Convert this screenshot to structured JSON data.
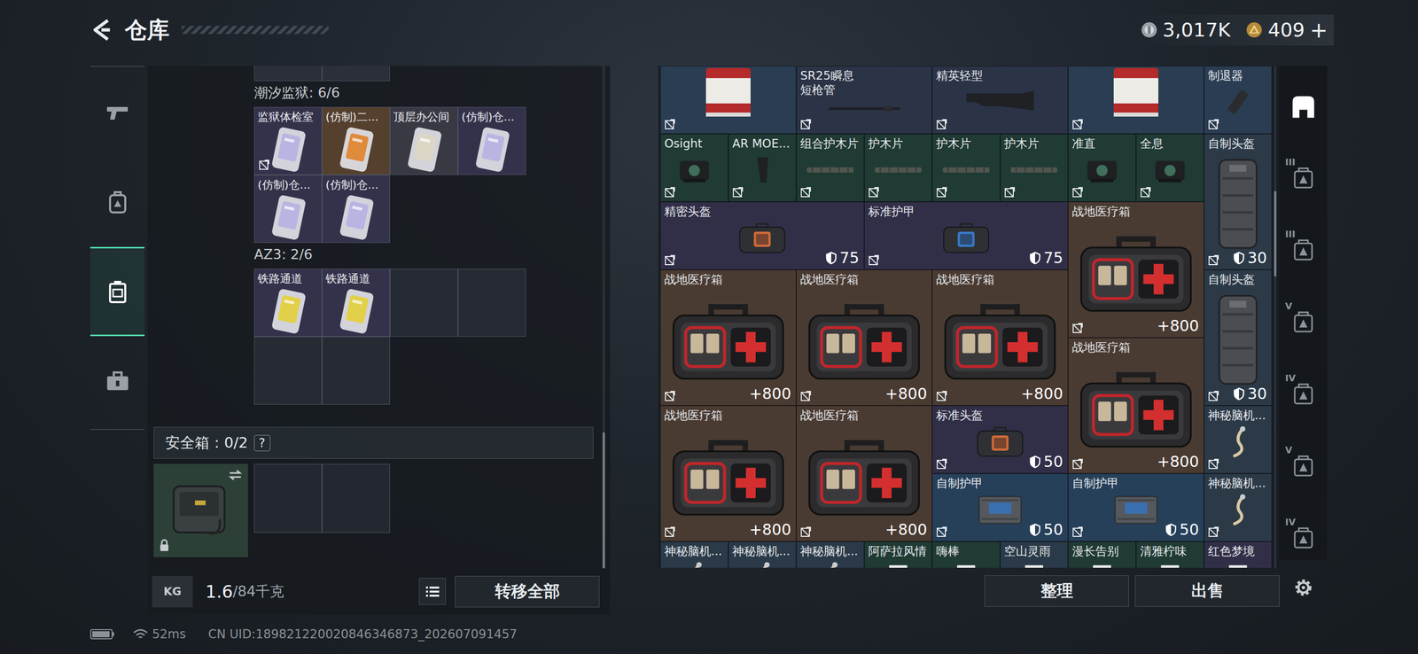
{
  "topbar": {
    "title": "仓库",
    "currencies": [
      {
        "kind": "coin",
        "value": "3,017K",
        "action": ""
      },
      {
        "kind": "gem",
        "value": "409",
        "action": "+"
      }
    ]
  },
  "rail": [
    {
      "kind": "weapon",
      "selected": false
    },
    {
      "kind": "gear",
      "selected": false
    },
    {
      "kind": "storage",
      "selected": true
    },
    {
      "kind": "tools",
      "selected": false
    }
  ],
  "keys": {
    "cut_row_cells": 2,
    "scrollbar": {
      "level": 0.27,
      "position": 1
    },
    "sections": [
      {
        "title": "潮汐监狱: 6/6",
        "slots": [
          {
            "name": "监狱体检室",
            "filled": true,
            "marked": true,
            "color": "#34324b",
            "card": "#b9b5e2"
          },
          {
            "name": "(仿制)二...",
            "filled": true,
            "marked": false,
            "color": "#55402e",
            "card": "#e08a3c"
          },
          {
            "name": "顶层办公间",
            "filled": true,
            "marked": false,
            "color": "#393944",
            "card": "#dcd6c6"
          },
          {
            "name": "(仿制)仓...",
            "filled": true,
            "marked": false,
            "color": "#34324b",
            "card": "#b9b5e2"
          },
          {
            "name": "(仿制)仓...",
            "filled": true,
            "marked": false,
            "color": "#34324b",
            "card": "#b9b5e2"
          },
          {
            "name": "(仿制)仓...",
            "filled": true,
            "marked": false,
            "color": "#34324b",
            "card": "#b9b5e2"
          }
        ]
      },
      {
        "title": "AZ3: 2/6",
        "slots": [
          {
            "name": "铁路通道",
            "filled": true,
            "marked": false,
            "color": "#34324b",
            "card": "#e2d04a"
          },
          {
            "name": "铁路通道",
            "filled": true,
            "marked": false,
            "color": "#34324b",
            "card": "#e2d04a"
          },
          {
            "filled": false
          },
          {
            "filled": false
          },
          {
            "filled": false
          },
          {
            "filled": false
          }
        ]
      }
    ]
  },
  "safebox": {
    "title": "安全箱：0/2",
    "help": "?",
    "case": {
      "locked": true
    },
    "slots": [
      {
        "filled": false
      },
      {
        "filled": false
      }
    ]
  },
  "weight": {
    "icon_text": "KG",
    "value": "1.6",
    "capacity": "/84千克"
  },
  "transfer_button": "转移全部",
  "storage": {
    "scrollbar": {
      "level": 0.17,
      "position": 0.3
    },
    "items": [
      {
        "label": "",
        "kind": "paint",
        "size": "2x1",
        "color": "#2a3d52"
      },
      {
        "label": "SR25瞬息\n短枪管",
        "kind": "barrel",
        "size": "2x1",
        "color": "#2b3346"
      },
      {
        "label": "精英轻型",
        "kind": "stock",
        "size": "2x1",
        "color": "#2b3346"
      },
      {
        "label": "",
        "kind": "paint",
        "size": "2x1",
        "color": "#2a3d52"
      },
      {
        "label": "制退器",
        "kind": "muzzle",
        "size": "1x1",
        "color": "#2a3d52"
      },
      {
        "label": "Osight",
        "kind": "scope",
        "size": "1x1",
        "color": "#203a34"
      },
      {
        "label": "AR MOE...",
        "kind": "grip",
        "size": "1x1",
        "color": "#203a34"
      },
      {
        "label": "组合护木片",
        "kind": "handguard",
        "size": "1x1",
        "color": "#203a34"
      },
      {
        "label": "护木片",
        "kind": "handguard",
        "size": "1x1",
        "color": "#203a34"
      },
      {
        "label": "护木片",
        "kind": "handguard",
        "size": "1x1",
        "color": "#203a34"
      },
      {
        "label": "护木片",
        "kind": "handguard",
        "size": "1x1",
        "color": "#203a34"
      },
      {
        "label": "准直",
        "kind": "scope",
        "size": "1x1",
        "color": "#203a34"
      },
      {
        "label": "全息",
        "kind": "scope",
        "size": "1x1",
        "color": "#203a34"
      },
      {
        "label": "自制头盔",
        "kind": "pack",
        "size": "1x2",
        "color": "#2c3a48",
        "stat": {
          "kind": "armor",
          "value": "30"
        }
      },
      {
        "label": "精密头盔",
        "kind": "helmet-bag",
        "size": "3x1",
        "color": "#312f48",
        "stat": {
          "kind": "armor",
          "value": "75"
        }
      },
      {
        "label": "标准护甲",
        "kind": "armor-bag",
        "size": "3x1",
        "color": "#312f48",
        "stat": {
          "kind": "armor",
          "value": "75"
        }
      },
      {
        "label": "战地医疗箱",
        "kind": "medkit",
        "size": "2x2",
        "color": "#4a3b32",
        "stat": {
          "kind": "heal",
          "value": "+800"
        }
      },
      {
        "label": "战地医疗箱",
        "kind": "medkit",
        "size": "2x2",
        "color": "#4a3b32",
        "stat": {
          "kind": "heal",
          "value": "+800"
        }
      },
      {
        "label": "战地医疗箱",
        "kind": "medkit",
        "size": "2x2",
        "color": "#4a3b32",
        "stat": {
          "kind": "heal",
          "value": "+800"
        }
      },
      {
        "label": "战地医疗箱",
        "kind": "medkit",
        "size": "2x2",
        "color": "#4a3b32",
        "stat": {
          "kind": "heal",
          "value": "+800"
        }
      },
      {
        "label": "自制头盔",
        "kind": "pack",
        "size": "1x2",
        "color": "#2c3a48",
        "stat": {
          "kind": "armor",
          "value": "30"
        }
      },
      {
        "label": "战地医疗箱",
        "kind": "medkit",
        "size": "2x2",
        "color": "#4a3b32",
        "stat": {
          "kind": "heal",
          "value": "+800"
        }
      },
      {
        "label": "战地医疗箱",
        "kind": "medkit",
        "size": "2x2",
        "color": "#4a3b32",
        "stat": {
          "kind": "heal",
          "value": "+800"
        }
      },
      {
        "label": "战地医疗箱",
        "kind": "medkit",
        "size": "2x2",
        "color": "#4a3b32",
        "stat": {
          "kind": "heal",
          "value": "+800"
        }
      },
      {
        "label": "标准头盔",
        "kind": "helmet-bag",
        "size": "2x1",
        "color": "#312f48",
        "stat": {
          "kind": "armor",
          "value": "50"
        }
      },
      {
        "label": "神秘脑机...",
        "kind": "brain",
        "size": "1x1",
        "color": "#2c3a48"
      },
      {
        "label": "自制护甲",
        "kind": "vest",
        "size": "2x1",
        "color": "#27405a",
        "stat": {
          "kind": "armor",
          "value": "50"
        }
      },
      {
        "label": "自制护甲",
        "kind": "vest",
        "size": "2x1",
        "color": "#27405a",
        "stat": {
          "kind": "armor",
          "value": "50"
        }
      },
      {
        "label": "神秘脑机...",
        "kind": "brain",
        "size": "1x1",
        "color": "#2c3a48"
      },
      {
        "label": "神秘脑机...",
        "kind": "brain",
        "size": "1x1",
        "color": "#2a3a48"
      },
      {
        "label": "神秘脑机...",
        "kind": "brain",
        "size": "1x1",
        "color": "#2a3a48"
      },
      {
        "label": "神秘脑机...",
        "kind": "brain",
        "size": "1x1",
        "color": "#2a3a48"
      },
      {
        "label": "阿萨拉风情",
        "kind": "drink",
        "size": "1x1",
        "color": "#203a34"
      },
      {
        "label": "嗨棒",
        "kind": "drink",
        "size": "1x1",
        "color": "#203a34"
      },
      {
        "label": "空山灵雨",
        "kind": "drink",
        "size": "1x1",
        "color": "#2a3a48"
      },
      {
        "label": "漫长告别",
        "kind": "drink",
        "size": "1x1",
        "color": "#203a34"
      },
      {
        "label": "清雅柠味",
        "kind": "drink",
        "size": "1x1",
        "color": "#203a34"
      },
      {
        "label": "红色梦境",
        "kind": "drink",
        "size": "1x1",
        "color": "#312f48"
      }
    ]
  },
  "actions": [
    "整理",
    "出售"
  ],
  "side_tabs": [
    {
      "badge": "",
      "selected": true
    },
    {
      "badge": "III",
      "selected": false
    },
    {
      "badge": "III",
      "selected": false
    },
    {
      "badge": "V",
      "selected": false
    },
    {
      "badge": "IV",
      "selected": false
    },
    {
      "badge": "V",
      "selected": false
    },
    {
      "badge": "IV",
      "selected": false
    }
  ],
  "status": {
    "ping": "52ms",
    "uid": "CN UID:189821220020846346873_202607091457"
  }
}
